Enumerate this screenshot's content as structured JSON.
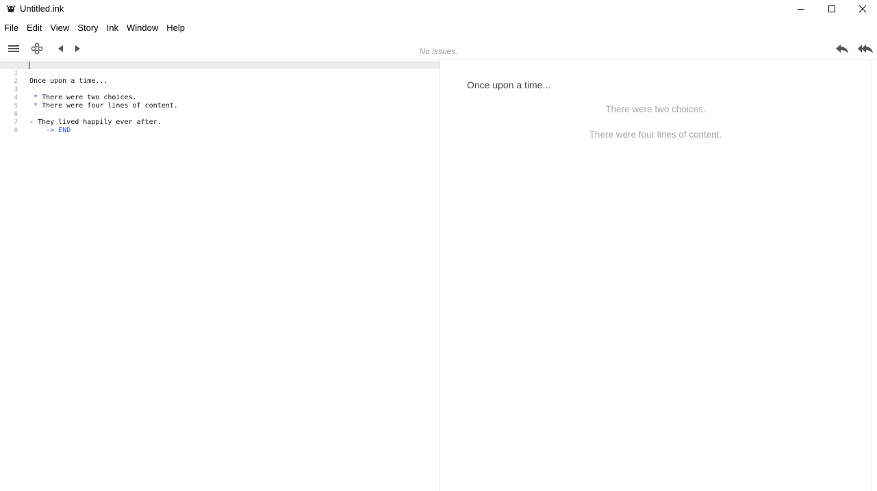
{
  "window": {
    "title": "Untitled.ink"
  },
  "menu": [
    "File",
    "Edit",
    "View",
    "Story",
    "Ink",
    "Window",
    "Help"
  ],
  "toolbar": {
    "status": "No issues."
  },
  "editor": {
    "lines": [
      {
        "num": "1",
        "prefix": "",
        "text": "Once upon a time..."
      },
      {
        "num": "2",
        "prefix": "",
        "text": ""
      },
      {
        "num": "3",
        "prefix": " * ",
        "text": "There were two choices."
      },
      {
        "num": "4",
        "prefix": " * ",
        "text": "There were four lines of content."
      },
      {
        "num": "5",
        "prefix": "",
        "text": ""
      },
      {
        "num": "6",
        "prefix": "",
        "text": "- They lived happily ever after."
      },
      {
        "num": "7",
        "prefix": "    -> ",
        "text": "END"
      },
      {
        "num": "8",
        "prefix": "",
        "text": ""
      }
    ]
  },
  "player": {
    "story_text": "Once upon a time...",
    "choices": [
      "There were two choices.",
      "There were four lines of content."
    ]
  },
  "colors": {
    "keyword": "#2a5bd7",
    "status": "#9a9a9a",
    "choice": "#a8a8a8"
  }
}
